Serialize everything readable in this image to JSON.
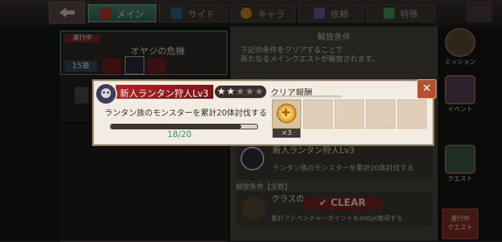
{
  "tabs": [
    {
      "label": "メイン",
      "active": true
    },
    {
      "label": "サイド",
      "active": false
    },
    {
      "label": "キャラ",
      "active": false
    },
    {
      "label": "依頼",
      "active": false
    },
    {
      "label": "特殊",
      "active": false
    }
  ],
  "quest_list": {
    "status_badge": "進行中",
    "quest_title": "オヤジの危機",
    "chapter": "15章"
  },
  "release_panel": {
    "heading": "解放条件",
    "description_line1": "下記の条件をクリアすることで",
    "description_line2": "新たなるメインクエストが解放されます。",
    "condition_title": "新人ランタン狩人Lv3",
    "condition_desc": "ランタン族のモンスターを累計20体討伐する",
    "section_label": "解放条件【全数】",
    "class_text": "クラスの",
    "clear_label": "CLEAR",
    "points_text": "累計アドベンチャーポイントを400pt獲得する"
  },
  "side_icons": [
    {
      "name": "mission",
      "label": "ミッション"
    },
    {
      "name": "event",
      "label": "イベント"
    },
    {
      "name": "quest",
      "label": "クエスト"
    },
    {
      "name": "in-progress-quest",
      "label_line1": "進行中",
      "label_line2": "クエスト"
    }
  ],
  "modal": {
    "title": "新人ランタン狩人Lv3",
    "stars_filled": 2,
    "stars_total": 5,
    "description": "ランタン族のモンスターを累計20体討伐する",
    "progress_current": 18,
    "progress_total": 20,
    "progress_text": "18/20",
    "reward_label": "クリア報酬",
    "reward_quantity": "×3",
    "reward_slots": 5
  },
  "colors": {
    "title_bar": "#b02424",
    "progress_text": "#3f8a73",
    "close_button": "#b5502d",
    "active_tab": "#4e8f74"
  },
  "icons": {
    "back": "back-arrow-icon",
    "close": "close-icon",
    "reward": "gold-coin-icon",
    "avatar": "lantern-monster-icon"
  }
}
